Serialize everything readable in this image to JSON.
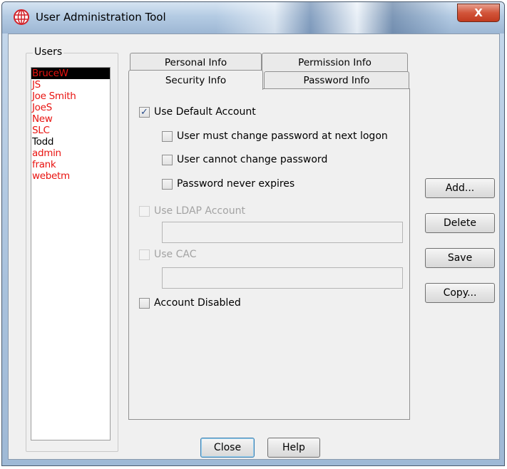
{
  "window": {
    "title": "User Administration Tool",
    "close_glyph": "X"
  },
  "users": {
    "caption": "Users",
    "items": [
      {
        "label": "BruceW",
        "color": "#e8120f",
        "selected": true
      },
      {
        "label": "JS",
        "color": "#e8120f",
        "selected": false
      },
      {
        "label": "Joe Smith",
        "color": "#e8120f",
        "selected": false
      },
      {
        "label": "JoeS",
        "color": "#e8120f",
        "selected": false
      },
      {
        "label": "New",
        "color": "#e8120f",
        "selected": false
      },
      {
        "label": "SLC",
        "color": "#e8120f",
        "selected": false
      },
      {
        "label": "Todd",
        "color": "#000000",
        "selected": false
      },
      {
        "label": "admin",
        "color": "#e8120f",
        "selected": false
      },
      {
        "label": "frank",
        "color": "#e8120f",
        "selected": false
      },
      {
        "label": "webetm",
        "color": "#e8120f",
        "selected": false
      }
    ]
  },
  "tabs": {
    "personal": "Personal Info",
    "permission": "Permission Info",
    "security": "Security Info",
    "password": "Password Info",
    "active": "Security Info"
  },
  "security": {
    "use_default": {
      "label": "Use Default Account",
      "checked": true,
      "enabled": true
    },
    "must_change": {
      "label": "User must change password at next logon",
      "checked": false,
      "enabled": true
    },
    "cannot_change": {
      "label": "User cannot change password",
      "checked": false,
      "enabled": true
    },
    "never_expires": {
      "label": "Password never expires",
      "checked": false,
      "enabled": true
    },
    "use_ldap": {
      "label": "Use LDAP Account",
      "checked": false,
      "enabled": false
    },
    "ldap_value": "",
    "use_cac": {
      "label": "Use CAC",
      "checked": false,
      "enabled": false
    },
    "cac_value": "",
    "account_disabled": {
      "label": "Account Disabled",
      "checked": false,
      "enabled": true
    }
  },
  "side_buttons": {
    "add": "Add...",
    "delete": "Delete",
    "save": "Save",
    "copy": "Copy..."
  },
  "bottom_buttons": {
    "close": "Close",
    "help": "Help"
  },
  "colors": {
    "user_red": "#e8120f",
    "selection_bg": "#000000"
  }
}
